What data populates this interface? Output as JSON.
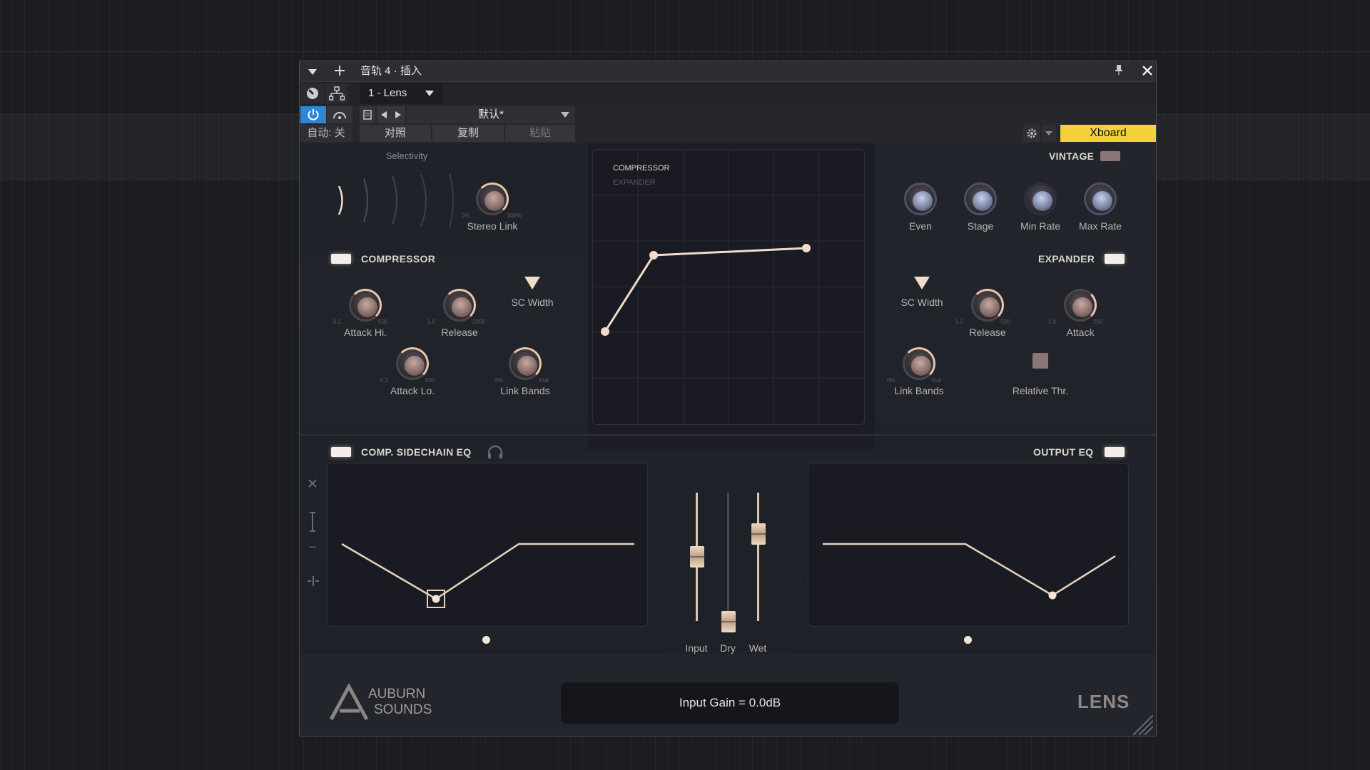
{
  "window": {
    "title": "音轨 4 · 插入",
    "plugin_slot": "1 - Lens",
    "preset_name": "默认*",
    "auto_label": "自动: 关",
    "compare_label": "对照",
    "copy_label": "复制",
    "paste_label": "粘贴",
    "xboard_label": "Xboard",
    "power_active_color": "#2f86d6",
    "xboard_color": "#f2d13a"
  },
  "plugin": {
    "selectivity_label": "Selectivity",
    "stereo_link": {
      "label": "Stereo Link",
      "min": "0%",
      "max": "100%"
    },
    "vintage_label": "VINTAGE",
    "vintage_knobs": [
      "Even",
      "Stage",
      "Min Rate",
      "Max Rate"
    ],
    "compressor": {
      "header": "COMPRESSOR",
      "attack_hi": {
        "label": "Attack Hi.",
        "min": "0.2",
        "max": "500"
      },
      "release": {
        "label": "Release",
        "min": "5.0",
        "max": "2000"
      },
      "attack_lo": {
        "label": "Attack Lo.",
        "min": "0.2",
        "max": "500"
      },
      "sc_width": "SC Width",
      "link_bands": {
        "label": "Link Bands",
        "min": "0%",
        "max": "Full"
      }
    },
    "transfer_graph": {
      "mode_compressor": "COMPRESSOR",
      "mode_expander": "EXPANDER"
    },
    "expander": {
      "header": "EXPANDER",
      "sc_width": "SC Width",
      "release": {
        "label": "Release",
        "min": "5.0",
        "max": "500"
      },
      "attack": {
        "label": "Attack",
        "min": "1.0",
        "max": "250"
      },
      "link_bands": {
        "label": "Link Bands",
        "min": "0%",
        "max": "Full"
      },
      "relative_thr": "Relative Thr."
    },
    "comp_sidechain_eq": {
      "header": "COMP. SIDECHAIN EQ"
    },
    "output_eq": {
      "header": "OUTPUT EQ"
    },
    "faders": {
      "input": "Input",
      "dry": "Dry",
      "wet": "Wet"
    },
    "status_text": "Input Gain = 0.0dB",
    "brand": {
      "line1": "AUBURN",
      "line2": "SOUNDS",
      "product": "LENS"
    }
  }
}
